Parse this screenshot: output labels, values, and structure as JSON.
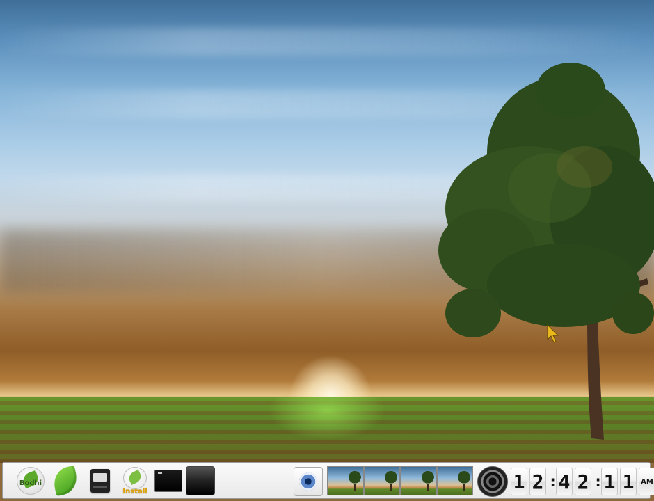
{
  "desktop": {
    "wallpaper": "sunset field with tree"
  },
  "panel": {
    "launchers": [
      {
        "icon": "bodhi-menu-icon",
        "label": "Bodhi"
      },
      {
        "icon": "leaf-icon",
        "label": ""
      },
      {
        "icon": "terminal-icon",
        "label": ""
      },
      {
        "icon": "install-icon",
        "label": "Install"
      },
      {
        "icon": "terminal-window-icon",
        "label": ""
      },
      {
        "icon": "show-desktop-icon",
        "label": ""
      }
    ],
    "system_icon": "eye-icon",
    "pager": {
      "workspaces": 4
    },
    "volume_icon": "speaker-icon",
    "clock": {
      "h1": "1",
      "h2": "2",
      "m1": "4",
      "m2": "2",
      "s1": "1",
      "s2": "1",
      "sep": ":",
      "ampm": "AM"
    }
  },
  "colors": {
    "panel_bg": "#f3f3f3",
    "accent_green": "#5da92b",
    "install_label": "#e1a300"
  }
}
